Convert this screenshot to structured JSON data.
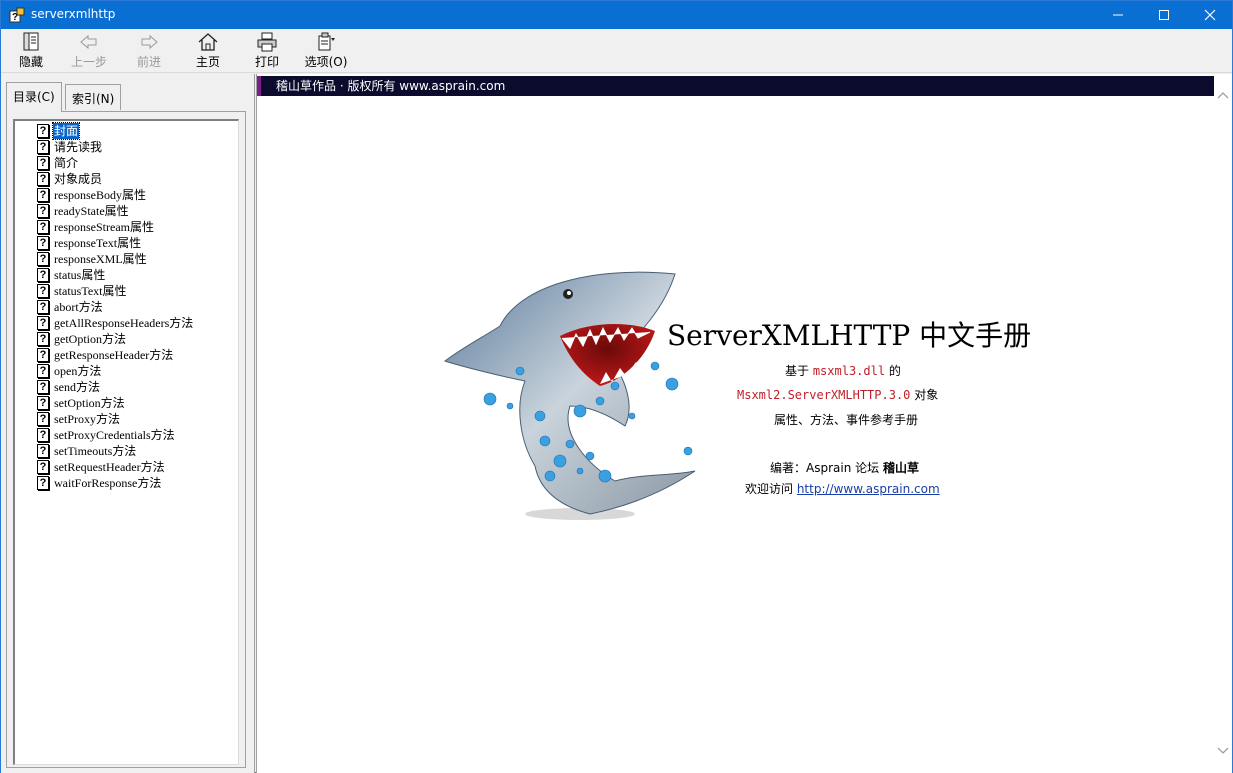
{
  "window": {
    "title": "serverxmlhttp"
  },
  "toolbar": {
    "hide": "隐藏",
    "back": "上一步",
    "forward": "前进",
    "home": "主页",
    "print": "打印",
    "options": "选项(O)"
  },
  "tabs": {
    "contents": "目录(C)",
    "index": "索引(N)"
  },
  "tree": {
    "items": [
      "封面",
      "请先读我",
      "简介",
      "对象成员",
      "responseBody属性",
      "readyState属性",
      "responseStream属性",
      "responseText属性",
      "responseXML属性",
      "status属性",
      "statusText属性",
      "abort方法",
      "getAllResponseHeaders方法",
      "getOption方法",
      "getResponseHeader方法",
      "open方法",
      "send方法",
      "setOption方法",
      "setProxy方法",
      "setProxyCredentials方法",
      "setTimeouts方法",
      "setRequestHeader方法",
      "waitForResponse方法"
    ],
    "selected_index": 0
  },
  "content": {
    "banner": "稽山草作品 · 版权所有  www.asprain.com",
    "title": "ServerXMLHTTP 中文手册",
    "line1_prefix": "基于 ",
    "line1_dll": "msxml3.dll",
    "line1_suffix": " 的",
    "line2_obj": "Msxml2.ServerXMLHTTP.3.0",
    "line2_suffix": " 对象",
    "line3": "属性、方法、事件参考手册",
    "author_prefix": "编著：Asprain 论坛  ",
    "author_name": "稽山草",
    "visit_prefix": "欢迎访问 ",
    "visit_url": "http://www.asprain.com"
  },
  "colors": {
    "titlebar": "#0a6fd3",
    "banner": "#0b0b2e",
    "accent_red": "#c0202a",
    "link": "#1a3ea8"
  }
}
